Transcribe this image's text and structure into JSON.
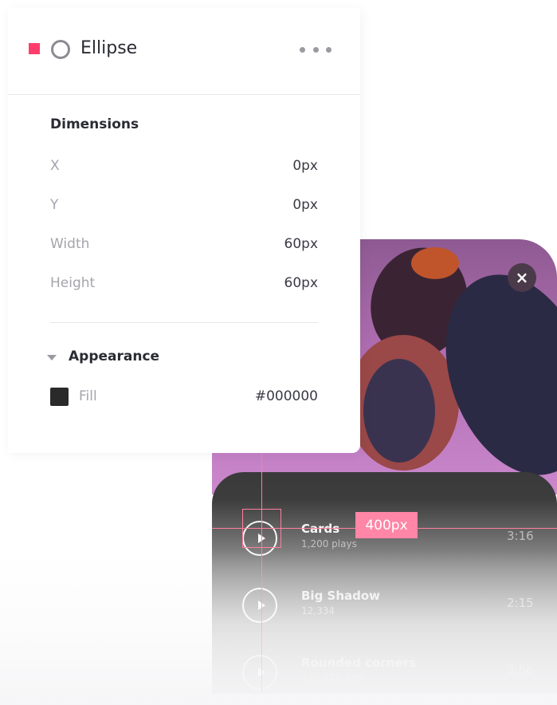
{
  "panel": {
    "layer_name": "Ellipse",
    "accent_color": "#ff3d6d",
    "icons": {
      "layer": "ellipse-icon",
      "more": "more-options-icon"
    },
    "dimensions": {
      "title": "Dimensions",
      "rows": [
        {
          "label": "X",
          "value": "0px"
        },
        {
          "label": "Y",
          "value": "0px"
        },
        {
          "label": "Width",
          "value": "60px"
        },
        {
          "label": "Height",
          "value": "60px"
        }
      ]
    },
    "appearance": {
      "title": "Appearance",
      "fill_label": "Fill",
      "fill_value": "#000000"
    }
  },
  "canvas": {
    "measurement_label": "400px",
    "guide_color": "#ff7f9e",
    "close_icon": "close-icon",
    "tracks": [
      {
        "title": "Cards",
        "subtitle": "1,200 plays",
        "duration": "3:16"
      },
      {
        "title": "Big Shadow",
        "subtitle": "12,334",
        "duration": "2:15"
      },
      {
        "title": "Rounded corners",
        "subtitle": "121,323,323",
        "duration": "3:56"
      }
    ]
  }
}
